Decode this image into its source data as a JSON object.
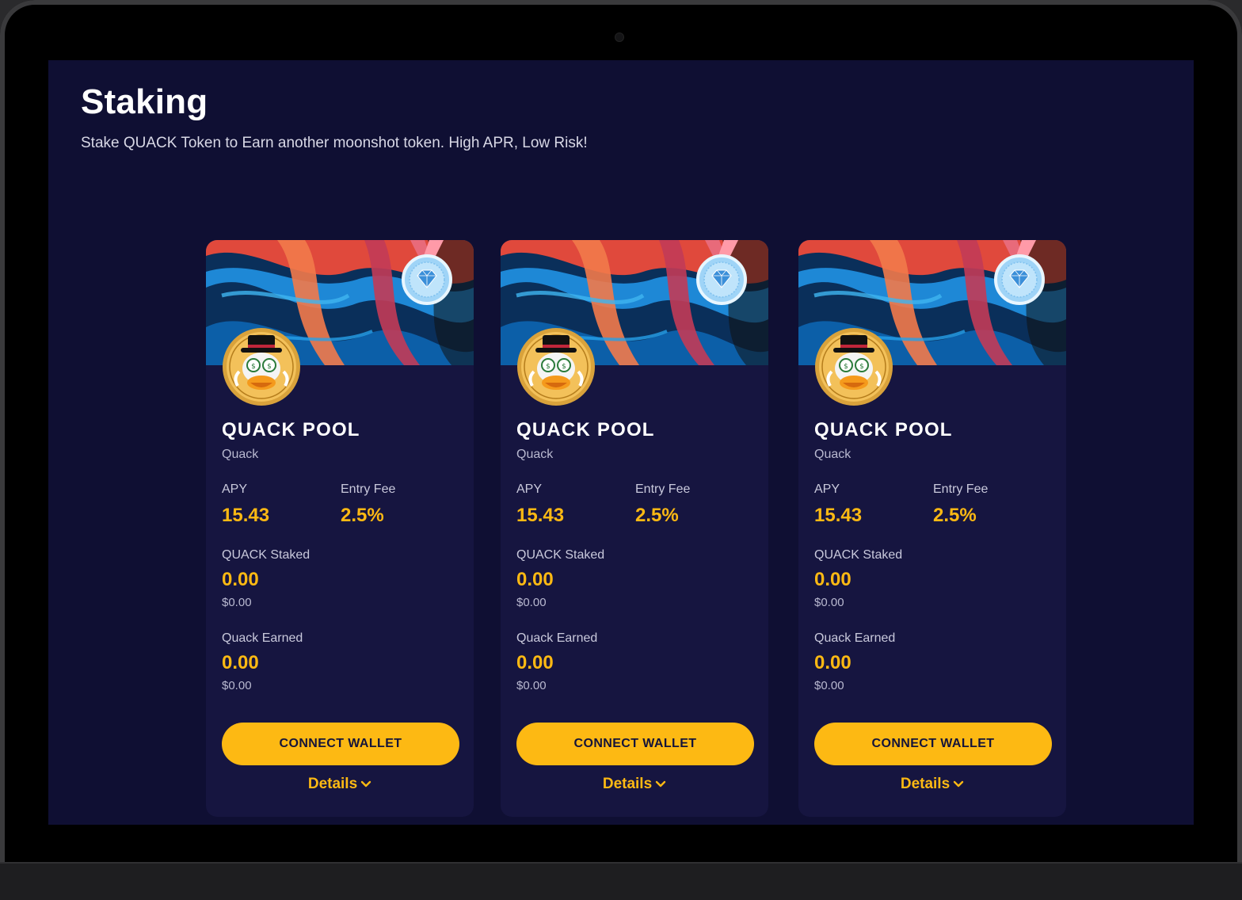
{
  "page": {
    "title": "Staking",
    "subtitle": "Stake QUACK Token to Earn another moonshot token. High APR, Low Risk!"
  },
  "colors": {
    "screen_bg": "#0f0f33",
    "card_bg": "#161540",
    "accent": "#fdb913",
    "button_text": "#14143a"
  },
  "icons": {
    "medal": "diamond-medal-icon",
    "token": "quack-duck-token-icon",
    "chevron": "chevron-down-icon"
  },
  "pools": [
    {
      "name": "QUACK POOL",
      "token": "Quack",
      "apy_label": "APY",
      "apy": "15.43",
      "fee_label": "Entry Fee",
      "fee": "2.5%",
      "staked_label": "QUACK Staked",
      "staked": "0.00",
      "staked_usd": "$0.00",
      "earned_label": "Quack Earned",
      "earned": "0.00",
      "earned_usd": "$0.00",
      "button": "CONNECT WALLET",
      "details": "Details"
    },
    {
      "name": "QUACK POOL",
      "token": "Quack",
      "apy_label": "APY",
      "apy": "15.43",
      "fee_label": "Entry Fee",
      "fee": "2.5%",
      "staked_label": "QUACK Staked",
      "staked": "0.00",
      "staked_usd": "$0.00",
      "earned_label": "Quack Earned",
      "earned": "0.00",
      "earned_usd": "$0.00",
      "button": "CONNECT WALLET",
      "details": "Details"
    },
    {
      "name": "QUACK POOL",
      "token": "Quack",
      "apy_label": "APY",
      "apy": "15.43",
      "fee_label": "Entry Fee",
      "fee": "2.5%",
      "staked_label": "QUACK Staked",
      "staked": "0.00",
      "staked_usd": "$0.00",
      "earned_label": "Quack Earned",
      "earned": "0.00",
      "earned_usd": "$0.00",
      "button": "CONNECT WALLET",
      "details": "Details"
    }
  ]
}
